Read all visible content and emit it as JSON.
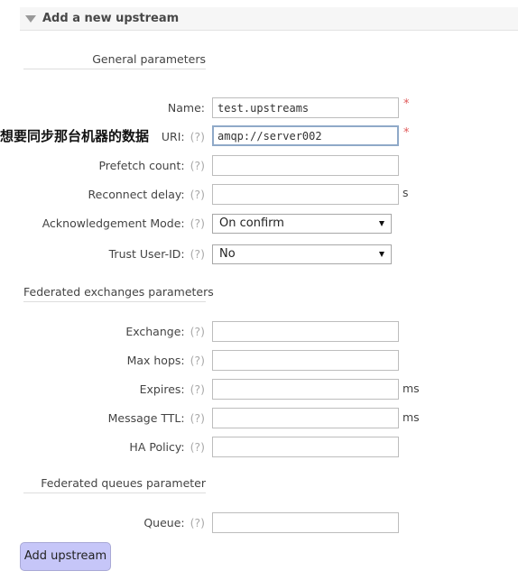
{
  "section": {
    "title": "Add a new upstream"
  },
  "groups": {
    "general": "General parameters",
    "exchanges": "Federated exchanges parameters",
    "queues": "Federated queues parameter"
  },
  "help": "(?)",
  "required_mark": "*",
  "fields": {
    "name": {
      "label": "Name:",
      "value": "test.upstreams"
    },
    "uri": {
      "label": "URI:",
      "value": "amqp://server002"
    },
    "prefetch_count": {
      "label": "Prefetch count:",
      "value": ""
    },
    "reconnect_delay": {
      "label": "Reconnect delay:",
      "value": "",
      "unit": "s"
    },
    "ack_mode": {
      "label": "Acknowledgement Mode:",
      "value": "On confirm"
    },
    "trust_user_id": {
      "label": "Trust User-ID:",
      "value": "No"
    },
    "exchange": {
      "label": "Exchange:",
      "value": ""
    },
    "max_hops": {
      "label": "Max hops:",
      "value": ""
    },
    "expires": {
      "label": "Expires:",
      "value": "",
      "unit": "ms"
    },
    "message_ttl": {
      "label": "Message TTL:",
      "value": "",
      "unit": "ms"
    },
    "ha_policy": {
      "label": "HA Policy:",
      "value": ""
    },
    "queue": {
      "label": "Queue:",
      "value": ""
    }
  },
  "annotation": "想要同步那台机器的数据",
  "buttons": {
    "add": "Add upstream"
  },
  "colors": {
    "button_bg": "#c6c6f8",
    "required": "#e05a5a",
    "help": "#aaaaaa"
  },
  "icons": {
    "section_toggle": "triangle-down-icon",
    "select_arrow": "chevron-down-icon"
  }
}
